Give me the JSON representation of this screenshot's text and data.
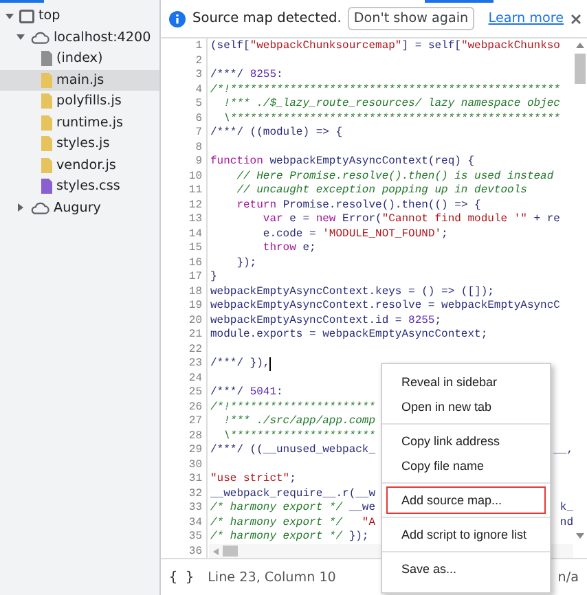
{
  "sidebar": {
    "tree": [
      {
        "label": "top",
        "kind": "frame",
        "expanded": true,
        "selected": false,
        "children": [
          {
            "label": "localhost:4200",
            "kind": "origin",
            "expanded": true,
            "selected": false,
            "children": [
              {
                "label": "(index)",
                "kind": "document",
                "selected": false
              },
              {
                "label": "main.js",
                "kind": "script",
                "selected": true
              },
              {
                "label": "polyfills.js",
                "kind": "script",
                "selected": false
              },
              {
                "label": "runtime.js",
                "kind": "script",
                "selected": false
              },
              {
                "label": "styles.js",
                "kind": "script",
                "selected": false
              },
              {
                "label": "vendor.js",
                "kind": "script",
                "selected": false
              },
              {
                "label": "styles.css",
                "kind": "stylesheet",
                "selected": false
              }
            ]
          },
          {
            "label": "Augury",
            "kind": "origin",
            "expanded": false,
            "selected": false
          }
        ]
      }
    ]
  },
  "infobar": {
    "message": "Source map detected.",
    "button": "Don't show again",
    "link": "Learn more"
  },
  "editor": {
    "lines": [
      {
        "number": "1",
        "segments": [
          {
            "kind": "plain",
            "text": "(self["
          },
          {
            "kind": "string",
            "text": "\"webpackChunksourcemap\""
          },
          {
            "kind": "plain",
            "text": "] = self["
          },
          {
            "kind": "string",
            "text": "\"webpackChunkso"
          }
        ]
      },
      {
        "number": "2"
      },
      {
        "number": "3",
        "segments": [
          {
            "kind": "plain",
            "text": "/***/ "
          },
          {
            "kind": "number",
            "text": "8255"
          },
          {
            "kind": "plain",
            "text": ":"
          }
        ]
      },
      {
        "number": "4",
        "segments": [
          {
            "kind": "comment",
            "text": "/*!**************************************************"
          }
        ]
      },
      {
        "number": "5",
        "segments": [
          {
            "kind": "comment",
            "text": "  !*** ./$_lazy_route_resources/ lazy namespace objec"
          }
        ]
      },
      {
        "number": "6",
        "segments": [
          {
            "kind": "comment",
            "text": "  \\**************************************************"
          }
        ]
      },
      {
        "number": "7",
        "segments": [
          {
            "kind": "plain",
            "text": "/***/ ((module) => {"
          }
        ]
      },
      {
        "number": "8"
      },
      {
        "number": "9",
        "segments": [
          {
            "kind": "keyword",
            "text": "function"
          },
          {
            "kind": "plain",
            "text": " webpackEmptyAsyncContext(req) {"
          }
        ]
      },
      {
        "number": "10",
        "segments": [
          {
            "kind": "comment",
            "text": "    // Here Promise.resolve().then() is used instead"
          }
        ]
      },
      {
        "number": "11",
        "segments": [
          {
            "kind": "comment",
            "text": "    // uncaught exception popping up in devtools"
          }
        ]
      },
      {
        "number": "12",
        "segments": [
          {
            "kind": "keyword",
            "text": "    return"
          },
          {
            "kind": "plain",
            "text": " Promise.resolve().then(() => {"
          }
        ]
      },
      {
        "number": "13",
        "segments": [
          {
            "kind": "keyword",
            "text": "        var"
          },
          {
            "kind": "plain",
            "text": " e = "
          },
          {
            "kind": "keyword",
            "text": "new"
          },
          {
            "kind": "plain",
            "text": " Error("
          },
          {
            "kind": "string",
            "text": "\"Cannot find module '\""
          },
          {
            "kind": "plain",
            "text": " + re"
          }
        ]
      },
      {
        "number": "14",
        "segments": [
          {
            "kind": "plain",
            "text": "        e.code = "
          },
          {
            "kind": "string",
            "text": "'MODULE_NOT_FOUND'"
          },
          {
            "kind": "plain",
            "text": ";"
          }
        ]
      },
      {
        "number": "15",
        "segments": [
          {
            "kind": "keyword",
            "text": "        throw"
          },
          {
            "kind": "plain",
            "text": " e;"
          }
        ]
      },
      {
        "number": "16",
        "segments": [
          {
            "kind": "plain",
            "text": "    });"
          }
        ]
      },
      {
        "number": "17",
        "segments": [
          {
            "kind": "plain",
            "text": "}"
          }
        ]
      },
      {
        "number": "18",
        "segments": [
          {
            "kind": "plain",
            "text": "webpackEmptyAsyncContext.keys = () => ([]);"
          }
        ]
      },
      {
        "number": "19",
        "segments": [
          {
            "kind": "plain",
            "text": "webpackEmptyAsyncContext.resolve = webpackEmptyAsyncC"
          }
        ]
      },
      {
        "number": "20",
        "segments": [
          {
            "kind": "plain",
            "text": "webpackEmptyAsyncContext.id = "
          },
          {
            "kind": "number",
            "text": "8255"
          },
          {
            "kind": "plain",
            "text": ";"
          }
        ]
      },
      {
        "number": "21",
        "segments": [
          {
            "kind": "plain",
            "text": "module.exports = webpackEmptyAsyncContext;"
          }
        ]
      },
      {
        "number": "22"
      },
      {
        "number": "23",
        "caret": true,
        "segments": [
          {
            "kind": "plain",
            "text": "/***/ }),"
          }
        ]
      },
      {
        "number": "24"
      },
      {
        "number": "25",
        "segments": [
          {
            "kind": "plain",
            "text": "/***/ "
          },
          {
            "kind": "number",
            "text": "5041"
          },
          {
            "kind": "plain",
            "text": ":"
          }
        ]
      },
      {
        "number": "26",
        "segments": [
          {
            "kind": "comment",
            "text": "/*!**********************"
          }
        ]
      },
      {
        "number": "27",
        "segments": [
          {
            "kind": "comment",
            "text": "  !*** ./src/app/app.comp"
          }
        ]
      },
      {
        "number": "28",
        "segments": [
          {
            "kind": "comment",
            "text": "  \\**********************"
          }
        ]
      },
      {
        "number": "29",
        "tail": "__,",
        "segments": [
          {
            "kind": "plain",
            "text": "/***/ ((__unused_webpack_"
          }
        ]
      },
      {
        "number": "30"
      },
      {
        "number": "31",
        "segments": [
          {
            "kind": "string",
            "text": "\"use strict\""
          },
          {
            "kind": "plain",
            "text": ";"
          }
        ]
      },
      {
        "number": "32",
        "segments": [
          {
            "kind": "plain",
            "text": "__webpack_require__.r(__w"
          }
        ]
      },
      {
        "number": "33",
        "tail": "k_",
        "segments": [
          {
            "kind": "comment",
            "text": "/* harmony export */"
          },
          {
            "kind": "plain",
            "text": " __we"
          }
        ]
      },
      {
        "number": "34",
        "tail": "nd",
        "segments": [
          {
            "kind": "comment",
            "text": "/* harmony export */"
          },
          {
            "kind": "string",
            "text": "   \"A"
          }
        ]
      },
      {
        "number": "35",
        "segments": [
          {
            "kind": "comment",
            "text": "/* harmony export */"
          },
          {
            "kind": "plain",
            "text": " });"
          }
        ]
      },
      {
        "number": "36"
      }
    ]
  },
  "status_bar": {
    "format_icon": "{ }",
    "position": "Line 23, Column 10",
    "coverage": "n/a"
  },
  "context_menu": {
    "groups": [
      [
        {
          "label": "Reveal in sidebar",
          "highlighted": false
        },
        {
          "label": "Open in new tab",
          "highlighted": false
        }
      ],
      [
        {
          "label": "Copy link address",
          "highlighted": false
        },
        {
          "label": "Copy file name",
          "highlighted": false
        }
      ],
      [
        {
          "label": "Add source map...",
          "highlighted": true
        }
      ],
      [
        {
          "label": "Add script to ignore list",
          "highlighted": false
        }
      ],
      [
        {
          "label": "Save as...",
          "highlighted": false
        }
      ]
    ]
  }
}
